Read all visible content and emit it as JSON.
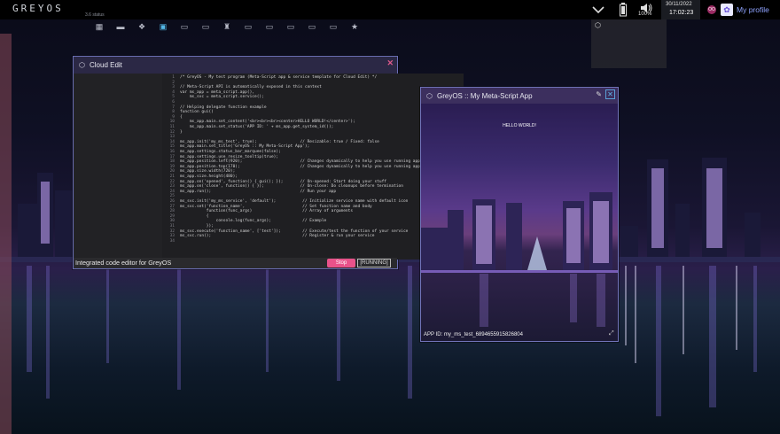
{
  "topbar": {
    "logo": "GREYOS",
    "logo_sub": "3.6 status",
    "battery": "100%",
    "date": "30/11/2022",
    "time": "17:02:23",
    "profile_initials": "OO",
    "profile_label": "My profile"
  },
  "icons": {
    "chevron": "chevron-down-icon",
    "battery": "battery-icon",
    "volume": "volume-icon",
    "cube": "cube-icon"
  },
  "dock": [
    {
      "name": "apps-grid-icon",
      "glyph": "▦"
    },
    {
      "name": "folder-icon",
      "glyph": "▬"
    },
    {
      "name": "paw-icon",
      "glyph": "❖"
    },
    {
      "name": "store-icon",
      "glyph": "▣"
    },
    {
      "name": "files-icon",
      "glyph": "▭"
    },
    {
      "name": "terminal-icon",
      "glyph": "▭"
    },
    {
      "name": "robot-icon",
      "glyph": "♜"
    },
    {
      "name": "window-icon",
      "glyph": "▭"
    },
    {
      "name": "window-icon",
      "glyph": "▭"
    },
    {
      "name": "window-icon",
      "glyph": "▭"
    },
    {
      "name": "window-icon",
      "glyph": "▭"
    },
    {
      "name": "window-icon",
      "glyph": "▭"
    },
    {
      "name": "star-icon",
      "glyph": "★"
    }
  ],
  "editor": {
    "title": "Cloud Edit",
    "status": "Integrated code editor for GreyOS",
    "stop_label": "Stop",
    "running_label": "[RUNNING]",
    "lines": [
      "/* GreyOS - My test program (Meta-Script app & service template for Cloud Edit) */",
      "",
      "// Meta-Script API is automatically exposed in this context",
      "var ms_app = meta_script.app(),",
      "    ms_svc = meta_script.service();",
      "",
      "// Helping delegate function example",
      "function gui()",
      "{",
      "    ms_app.main.set_content('<br><br><br><center>HELLO WORLD!</center>');",
      "    ms_app.main.set_status('APP ID: ' + ms_app.get_system_id());",
      "}",
      "",
      "ms_app.init('my_ms_test', true);                  // Resizable: true / Fixed: false",
      "ms_app.main.set_title('GreyOS :: My Meta-Script App');",
      "ms_app.settings.status_bar_marquee(false);",
      "ms_app.settings.use_resize_tooltip(true);",
      "ms_app.position.left(920);                        // Changes dynamically to help you use running apps",
      "ms_app.position.top(170);                         // Changes dynamically to help you use running apps",
      "ms_app.size.width(720);",
      "ms_app.size.height(480);",
      "ms_app.on('opened', function() { gui(); });       // On-opened: Start doing your stuff",
      "ms_app.on('close', function() { });               // On-close: Do cleanups before termination",
      "ms_app.run();                                     // Run your app",
      "",
      "ms_svc.init('my_ms_service', 'default');           // Initialize service name with default icon",
      "ms_svc.set('function_name',                        // Set function name and body",
      "           function(func_args)                     // Array of arguments",
      "           {",
      "               console.log(func_args);             // Example",
      "           });",
      "ms_svc.execute('function_name', ['test']);         // Execute/test the function of your service",
      "ms_svc.run();                                      // Register & run your service",
      ""
    ]
  },
  "meta": {
    "title": "GreyOS :: My Meta-Script App",
    "content": "HELLO WORLD!",
    "status": "APP ID: my_ms_test_6894655915826804"
  },
  "colors": {
    "accent": "#e8528a",
    "window_border": "#6b6fb5",
    "title_bar": "#2b2845",
    "profile_link": "#8fa3ff"
  }
}
